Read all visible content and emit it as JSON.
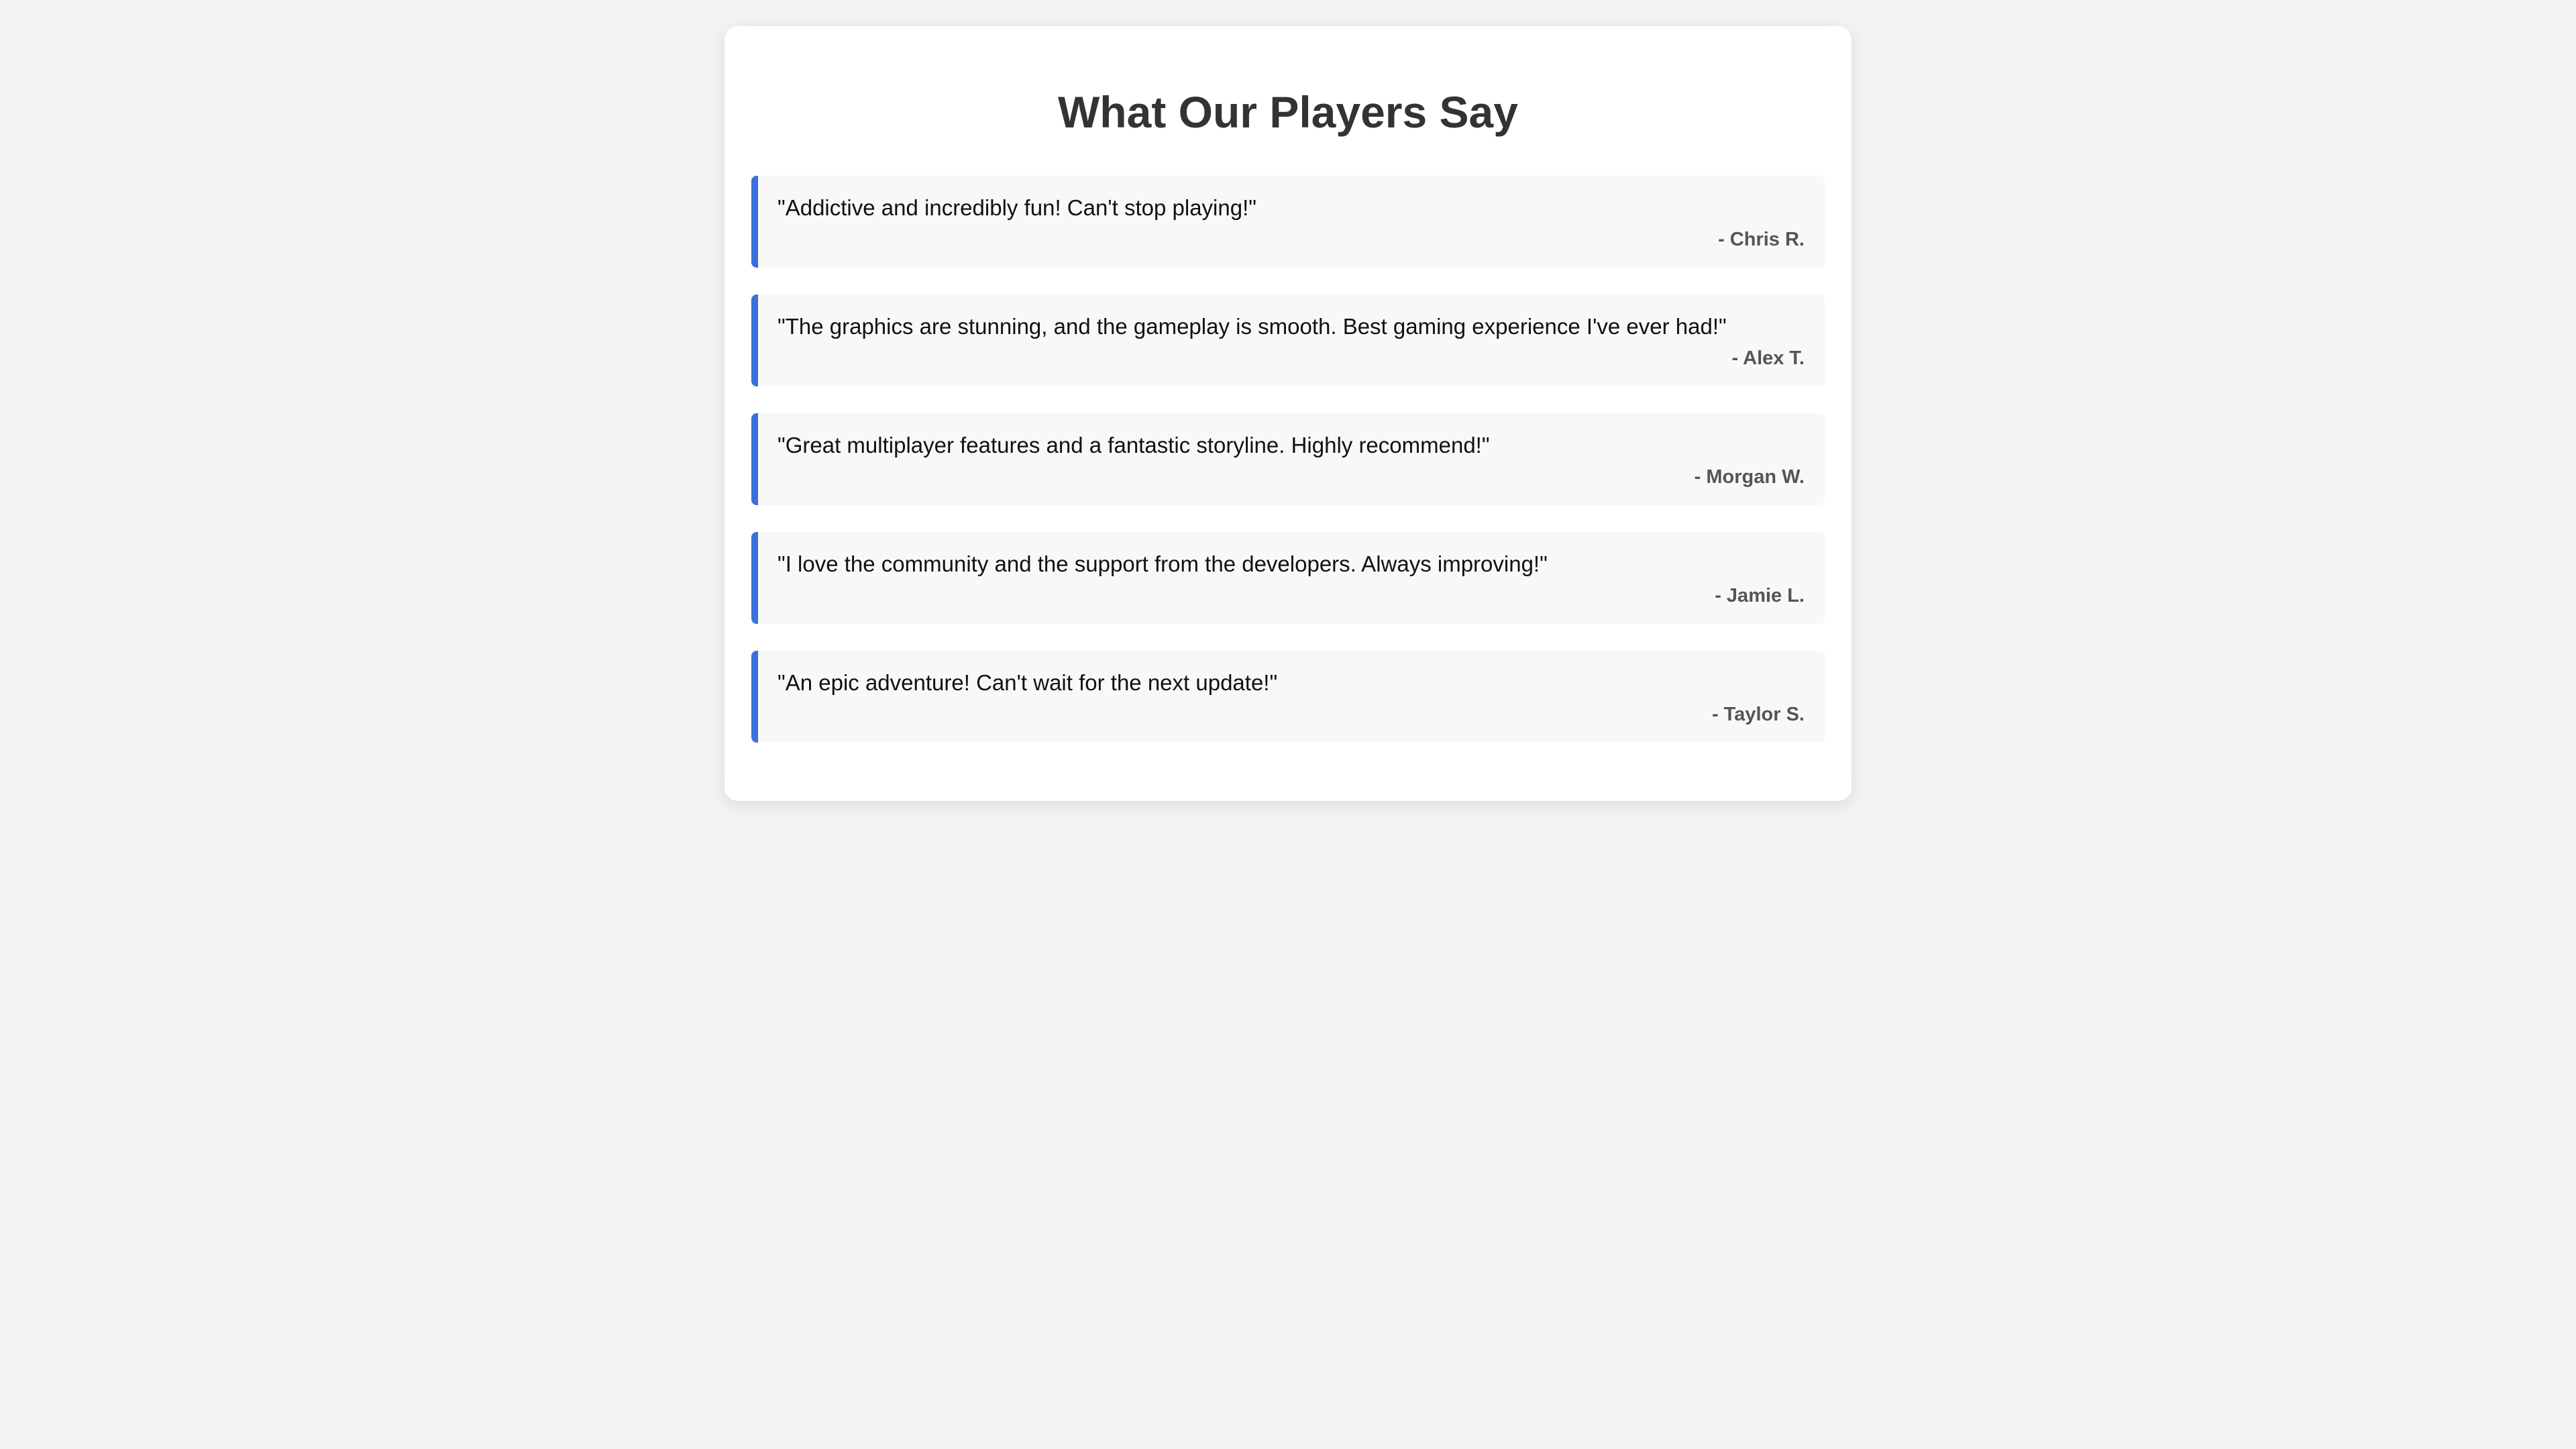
{
  "heading": "What Our Players Say",
  "testimonials": [
    {
      "quote": "\"Addictive and incredibly fun! Can't stop playing!\"",
      "author": "- Chris R."
    },
    {
      "quote": "\"The graphics are stunning, and the gameplay is smooth. Best gaming experience I've ever had!\"",
      "author": "- Alex T."
    },
    {
      "quote": "\"Great multiplayer features and a fantastic storyline. Highly recommend!\"",
      "author": "- Morgan W."
    },
    {
      "quote": "\"I love the community and the support from the developers. Always improving!\"",
      "author": "- Jamie L."
    },
    {
      "quote": "\"An epic adventure! Can't wait for the next update!\"",
      "author": "- Taylor S."
    }
  ],
  "colors": {
    "page_background": "#f3f3f3",
    "card_background": "#ffffff",
    "accent": "#3a6fdc",
    "item_background": "#f8f8f8",
    "title_text": "#333333",
    "author_text": "#555555"
  }
}
